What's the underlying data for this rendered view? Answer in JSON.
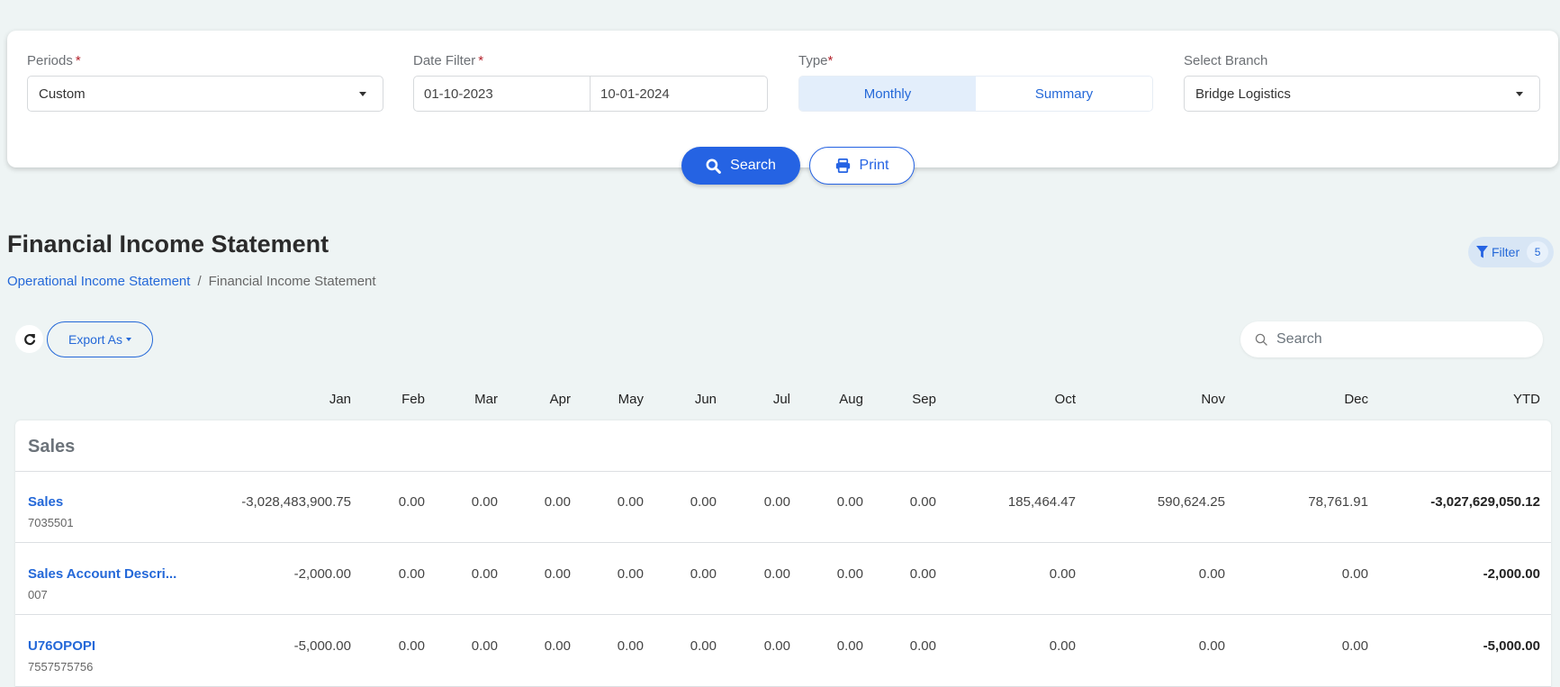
{
  "filters": {
    "periods": {
      "label": "Periods",
      "required": "*",
      "value": "Custom"
    },
    "date_filter": {
      "label": "Date Filter",
      "required": "*",
      "from": "01-10-2023",
      "to": "10-01-2024"
    },
    "type": {
      "label": "Type",
      "required": "*",
      "options": [
        "Monthly",
        "Summary"
      ],
      "selected": "Monthly"
    },
    "branch": {
      "label": "Select Branch",
      "value": "Bridge Logistics"
    },
    "search_button": "Search",
    "print_button": "Print"
  },
  "page": {
    "title": "Financial Income Statement",
    "breadcrumb": [
      {
        "label": "Operational Income Statement",
        "link": true
      },
      {
        "label": "Financial Income Statement",
        "link": false
      }
    ],
    "breadcrumb_separator": "/",
    "filter_button": {
      "label": "Filter",
      "count": "5"
    }
  },
  "toolbar": {
    "export_label": "Export As",
    "search_placeholder": "Search"
  },
  "table": {
    "columns": [
      "Jan",
      "Feb",
      "Mar",
      "Apr",
      "May",
      "Jun",
      "Jul",
      "Aug",
      "Sep",
      "Oct",
      "Nov",
      "Dec",
      "YTD"
    ],
    "section": "Sales",
    "rows": [
      {
        "name": "Sales",
        "code": "7035501",
        "values": [
          "-3,028,483,900.75",
          "0.00",
          "0.00",
          "0.00",
          "0.00",
          "0.00",
          "0.00",
          "0.00",
          "0.00",
          "185,464.47",
          "590,624.25",
          "78,761.91",
          "-3,027,629,050.12"
        ]
      },
      {
        "name": "Sales Account Descri...",
        "code": "007",
        "values": [
          "-2,000.00",
          "0.00",
          "0.00",
          "0.00",
          "0.00",
          "0.00",
          "0.00",
          "0.00",
          "0.00",
          "0.00",
          "0.00",
          "0.00",
          "-2,000.00"
        ]
      },
      {
        "name": "U76OPOPI",
        "code": "7557575756",
        "values": [
          "-5,000.00",
          "0.00",
          "0.00",
          "0.00",
          "0.00",
          "0.00",
          "0.00",
          "0.00",
          "0.00",
          "0.00",
          "0.00",
          "0.00",
          "-5,000.00"
        ]
      }
    ]
  },
  "colors": {
    "accent": "#2563e3",
    "link": "#2468d8",
    "background": "#eef4f4",
    "required": "#b3202a"
  }
}
